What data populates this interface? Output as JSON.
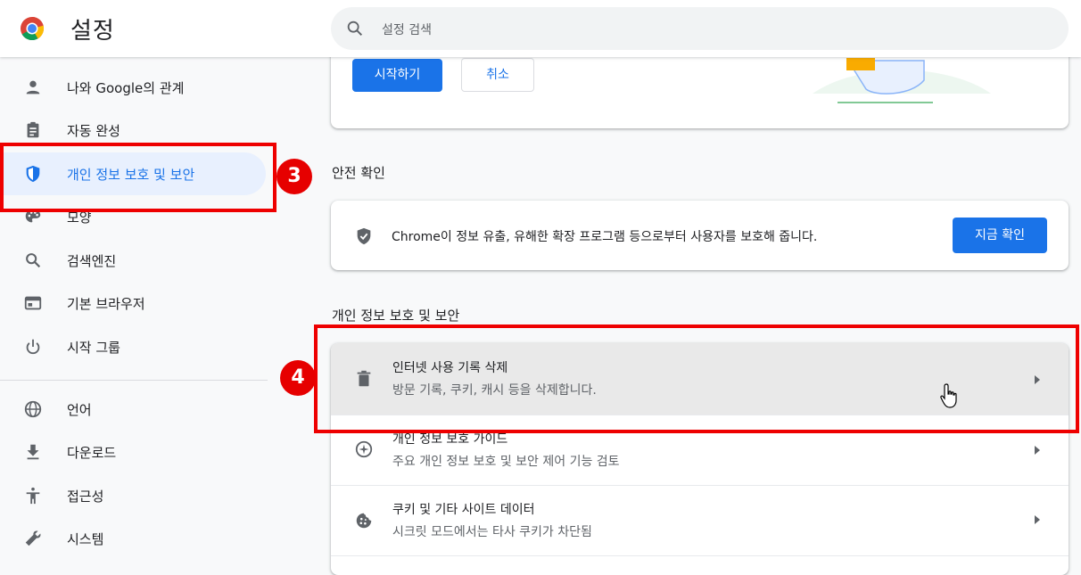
{
  "header": {
    "title": "설정",
    "search_placeholder": "설정 검색"
  },
  "sidebar": {
    "items": [
      {
        "label": "나와 Google의 관계",
        "icon": "person-icon"
      },
      {
        "label": "자동 완성",
        "icon": "clipboard-icon"
      },
      {
        "label": "개인 정보 보호 및 보안",
        "icon": "shield-icon",
        "active": true
      },
      {
        "label": "모양",
        "icon": "palette-icon"
      },
      {
        "label": "검색엔진",
        "icon": "search-icon"
      },
      {
        "label": "기본 브라우저",
        "icon": "browser-window-icon"
      },
      {
        "label": "시작 그룹",
        "icon": "power-icon"
      },
      {
        "label": "언어",
        "icon": "globe-icon"
      },
      {
        "label": "다운로드",
        "icon": "download-icon"
      },
      {
        "label": "접근성",
        "icon": "accessibility-icon"
      },
      {
        "label": "시스템",
        "icon": "wrench-icon"
      }
    ]
  },
  "top_card": {
    "start_label": "시작하기",
    "cancel_label": "취소"
  },
  "safety": {
    "section_title": "안전 확인",
    "text": "Chrome이 정보 유출, 유해한 확장 프로그램 등으로부터 사용자를 보호해 줍니다.",
    "button_label": "지금 확인"
  },
  "privacy": {
    "section_title": "개인 정보 보호 및 보안",
    "rows": [
      {
        "title": "인터넷 사용 기록 삭제",
        "subtitle": "방문 기록, 쿠키, 캐시 등을 삭제합니다.",
        "icon": "trash-icon"
      },
      {
        "title": "개인 정보 보호 가이드",
        "subtitle": "주요 개인 정보 보호 및 보안 제어 기능 검토",
        "icon": "compass-icon"
      },
      {
        "title": "쿠키 및 기타 사이트 데이터",
        "subtitle": "시크릿 모드에서는 타사 쿠키가 차단됨",
        "icon": "cookie-icon"
      }
    ]
  },
  "annotations": {
    "badge_3": "3",
    "badge_4": "4"
  },
  "colors": {
    "accent": "#1a73e8",
    "active_bg": "#e8f0fe",
    "annotation_red": "#ee0000"
  }
}
